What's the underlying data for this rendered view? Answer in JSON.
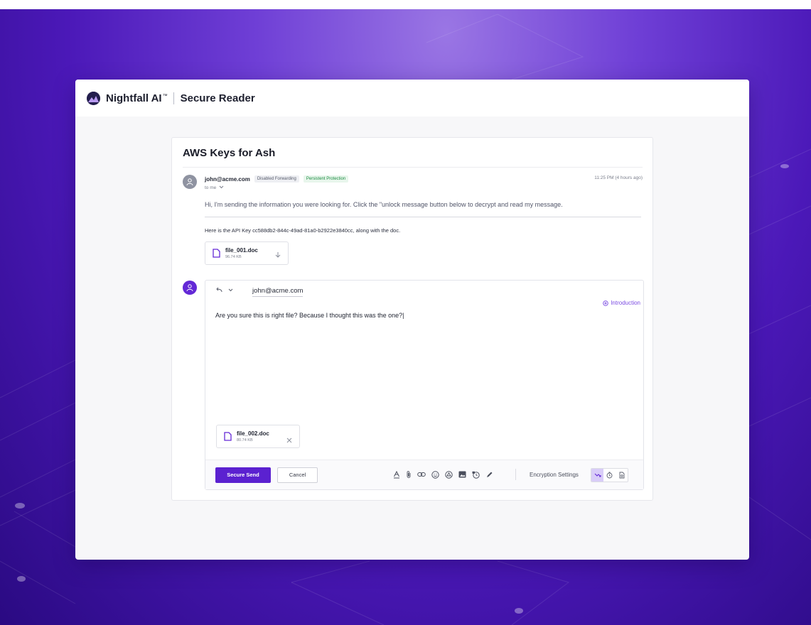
{
  "app": {
    "brand": "Nightfall AI",
    "brand_mark": "™",
    "product": "Secure Reader"
  },
  "message": {
    "subject": "AWS Keys for Ash",
    "sender": "john@acme.com",
    "badges": [
      "Disabled Forwarding",
      "Persistent Protection"
    ],
    "recipient_label": "to me",
    "timestamp": "11:25 PM (4 hours ago)",
    "body_line1": "Hi, I'm sending the information you were looking for. Click the \"unlock message button below to decrypt and read my message.",
    "body_line2": "Here is the API Key cc588db2-844c-49ad-81a0-b2922e3840cc, along with the doc.",
    "attachment": {
      "name": "file_001.doc",
      "size": "96.74 KB"
    }
  },
  "reply": {
    "recipient": "john@acme.com",
    "intro_link": "Introduction",
    "body": "Are you sure this is right file? Because I thought this was the one?|",
    "attachment": {
      "name": "file_002.doc",
      "size": "80.74 KB"
    },
    "send_label": "Secure Send",
    "cancel_label": "Cancel",
    "encryption_label": "Encryption Settings",
    "tool_icons": [
      "text-format-icon",
      "attach-icon",
      "link-icon",
      "emoji-icon",
      "drive-icon",
      "image-icon",
      "lock-clock-icon",
      "signature-icon"
    ],
    "encryption_icons": [
      "no-forward-icon",
      "timer-icon",
      "protect-icon"
    ]
  },
  "colors": {
    "accent": "#5b21d0",
    "link": "#7a4ae2",
    "badge_green": "#1e8d43"
  }
}
